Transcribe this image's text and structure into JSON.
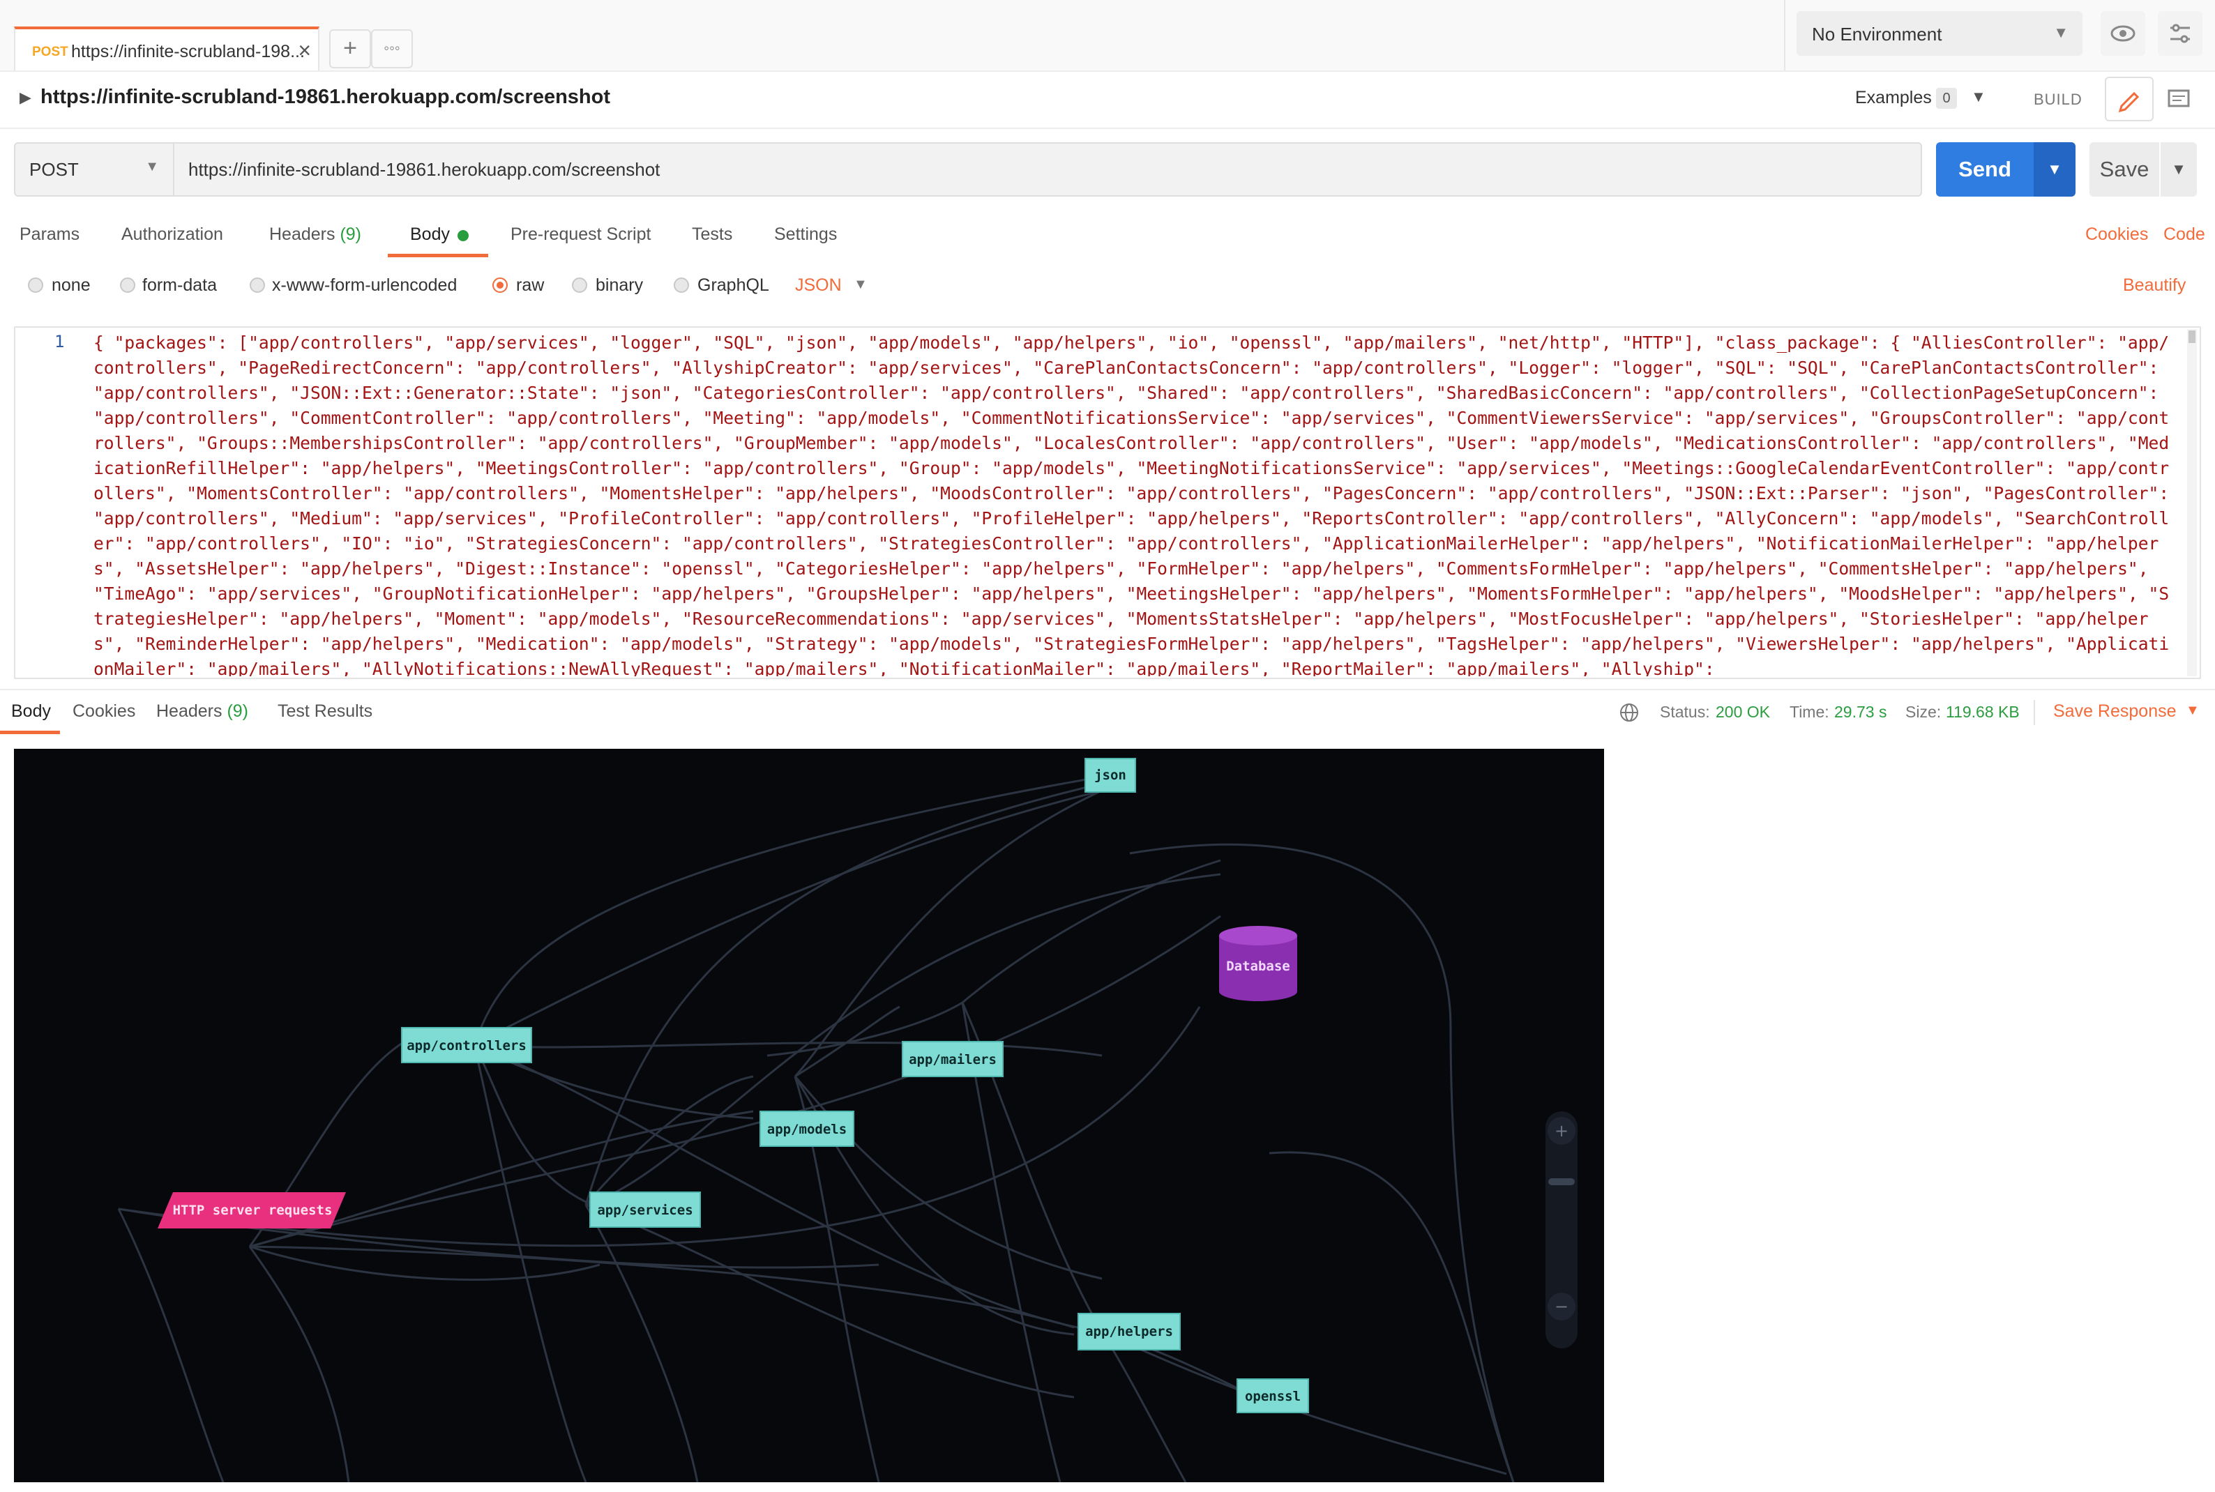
{
  "tab": {
    "method": "POST",
    "title": "https://infinite-scrubland-198..."
  },
  "environment": {
    "selected": "No Environment"
  },
  "request": {
    "name": "https://infinite-scrubland-19861.herokuapp.com/screenshot",
    "method": "POST",
    "url": "https://infinite-scrubland-19861.herokuapp.com/screenshot"
  },
  "toolbar": {
    "examples_label": "Examples",
    "examples_count": "0",
    "build_label": "BUILD",
    "send_label": "Send",
    "save_label": "Save"
  },
  "request_tabs": {
    "params": "Params",
    "authorization": "Authorization",
    "headers": "Headers",
    "headers_count": "(9)",
    "body": "Body",
    "prerequest": "Pre-request Script",
    "tests": "Tests",
    "settings": "Settings",
    "cookies": "Cookies",
    "code": "Code"
  },
  "body_modes": {
    "none": "none",
    "form_data": "form-data",
    "urlencoded": "x-www-form-urlencoded",
    "raw": "raw",
    "binary": "binary",
    "graphql": "GraphQL",
    "format": "JSON",
    "beautify": "Beautify"
  },
  "editor": {
    "line_number": "1",
    "code": "{ \"packages\": [\"app/controllers\", \"app/services\", \"logger\", \"SQL\", \"json\", \"app/models\", \"app/helpers\", \"io\", \"openssl\", \"app/mailers\", \"net/http\", \"HTTP\"], \"class_package\": { \"AlliesController\": \"app/controllers\", \"PageRedirectConcern\": \"app/controllers\", \"AllyshipCreator\": \"app/services\", \"CarePlanContactsConcern\": \"app/controllers\", \"Logger\": \"logger\", \"SQL\": \"SQL\", \"CarePlanContactsController\": \"app/controllers\", \"JSON::Ext::Generator::State\": \"json\", \"CategoriesController\": \"app/controllers\", \"Shared\": \"app/controllers\", \"SharedBasicConcern\": \"app/controllers\", \"CollectionPageSetupConcern\": \"app/controllers\", \"CommentController\": \"app/controllers\", \"Meeting\": \"app/models\", \"CommentNotificationsService\": \"app/services\", \"CommentViewersService\": \"app/services\", \"GroupsController\": \"app/controllers\", \"Groups::MembershipsController\": \"app/controllers\", \"GroupMember\": \"app/models\", \"LocalesController\": \"app/controllers\", \"User\": \"app/models\", \"MedicationsController\": \"app/controllers\", \"MedicationRefillHelper\": \"app/helpers\", \"MeetingsController\": \"app/controllers\", \"Group\": \"app/models\", \"MeetingNotificationsService\": \"app/services\", \"Meetings::GoogleCalendarEventController\": \"app/controllers\", \"MomentsController\": \"app/controllers\", \"MomentsHelper\": \"app/helpers\", \"MoodsController\": \"app/controllers\", \"PagesConcern\": \"app/controllers\", \"JSON::Ext::Parser\": \"json\", \"PagesController\": \"app/controllers\", \"Medium\": \"app/services\", \"ProfileController\": \"app/controllers\", \"ProfileHelper\": \"app/helpers\", \"ReportsController\": \"app/controllers\", \"AllyConcern\": \"app/models\", \"SearchController\": \"app/controllers\", \"IO\": \"io\", \"StrategiesConcern\": \"app/controllers\", \"StrategiesController\": \"app/controllers\", \"ApplicationMailerHelper\": \"app/helpers\", \"NotificationMailerHelper\": \"app/helpers\", \"AssetsHelper\": \"app/helpers\", \"Digest::Instance\": \"openssl\", \"CategoriesHelper\": \"app/helpers\", \"FormHelper\": \"app/helpers\", \"CommentsFormHelper\": \"app/helpers\", \"CommentsHelper\": \"app/helpers\", \"TimeAgo\": \"app/services\", \"GroupNotificationHelper\": \"app/helpers\", \"GroupsHelper\": \"app/helpers\", \"MeetingsHelper\": \"app/helpers\", \"MomentsFormHelper\": \"app/helpers\", \"MoodsHelper\": \"app/helpers\", \"StrategiesHelper\": \"app/helpers\", \"Moment\": \"app/models\", \"ResourceRecommendations\": \"app/services\", \"MomentsStatsHelper\": \"app/helpers\", \"MostFocusHelper\": \"app/helpers\", \"StoriesHelper\": \"app/helpers\", \"ReminderHelper\": \"app/helpers\", \"Medication\": \"app/models\", \"Strategy\": \"app/models\", \"StrategiesFormHelper\": \"app/helpers\", \"TagsHelper\": \"app/helpers\", \"ViewersHelper\": \"app/helpers\", \"ApplicationMailer\": \"app/mailers\", \"AllyNotifications::NewAllyRequest\": \"app/mailers\", \"NotificationMailer\": \"app/mailers\", \"ReportMailer\": \"app/mailers\", \"Allyship\":"
  },
  "response_tabs": {
    "body": "Body",
    "cookies": "Cookies",
    "headers": "Headers",
    "headers_count": "(9)",
    "test_results": "Test Results"
  },
  "response_status": {
    "status_label": "Status:",
    "status_value": "200 OK",
    "time_label": "Time:",
    "time_value": "29.73 s",
    "size_label": "Size:",
    "size_value": "119.68 KB",
    "save_response": "Save Response"
  },
  "graph": {
    "nodes": {
      "json": "json",
      "database": "Database",
      "controllers": "app/controllers",
      "mailers": "app/mailers",
      "models": "app/models",
      "http": "HTTP server requests",
      "services": "app/services",
      "helpers": "app/helpers",
      "openssl": "openssl"
    },
    "zoom_in": "+",
    "zoom_out": "−"
  },
  "colors": {
    "accent": "#f26b3a",
    "send": "#2f7de0",
    "success": "#2a9d3f",
    "node": "#7fdcd4",
    "database": "#8a2fb0",
    "http_node": "#e8307e"
  }
}
